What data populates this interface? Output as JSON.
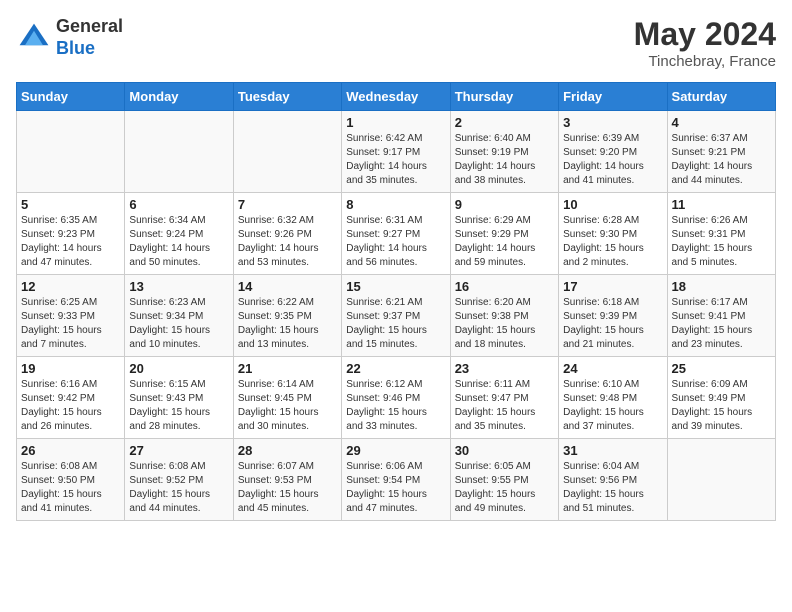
{
  "header": {
    "logo_general": "General",
    "logo_blue": "Blue",
    "month": "May 2024",
    "location": "Tinchebray, France"
  },
  "weekdays": [
    "Sunday",
    "Monday",
    "Tuesday",
    "Wednesday",
    "Thursday",
    "Friday",
    "Saturday"
  ],
  "weeks": [
    [
      {
        "day": "",
        "info": ""
      },
      {
        "day": "",
        "info": ""
      },
      {
        "day": "",
        "info": ""
      },
      {
        "day": "1",
        "info": "Sunrise: 6:42 AM\nSunset: 9:17 PM\nDaylight: 14 hours and 35 minutes."
      },
      {
        "day": "2",
        "info": "Sunrise: 6:40 AM\nSunset: 9:19 PM\nDaylight: 14 hours and 38 minutes."
      },
      {
        "day": "3",
        "info": "Sunrise: 6:39 AM\nSunset: 9:20 PM\nDaylight: 14 hours and 41 minutes."
      },
      {
        "day": "4",
        "info": "Sunrise: 6:37 AM\nSunset: 9:21 PM\nDaylight: 14 hours and 44 minutes."
      }
    ],
    [
      {
        "day": "5",
        "info": "Sunrise: 6:35 AM\nSunset: 9:23 PM\nDaylight: 14 hours and 47 minutes."
      },
      {
        "day": "6",
        "info": "Sunrise: 6:34 AM\nSunset: 9:24 PM\nDaylight: 14 hours and 50 minutes."
      },
      {
        "day": "7",
        "info": "Sunrise: 6:32 AM\nSunset: 9:26 PM\nDaylight: 14 hours and 53 minutes."
      },
      {
        "day": "8",
        "info": "Sunrise: 6:31 AM\nSunset: 9:27 PM\nDaylight: 14 hours and 56 minutes."
      },
      {
        "day": "9",
        "info": "Sunrise: 6:29 AM\nSunset: 9:29 PM\nDaylight: 14 hours and 59 minutes."
      },
      {
        "day": "10",
        "info": "Sunrise: 6:28 AM\nSunset: 9:30 PM\nDaylight: 15 hours and 2 minutes."
      },
      {
        "day": "11",
        "info": "Sunrise: 6:26 AM\nSunset: 9:31 PM\nDaylight: 15 hours and 5 minutes."
      }
    ],
    [
      {
        "day": "12",
        "info": "Sunrise: 6:25 AM\nSunset: 9:33 PM\nDaylight: 15 hours and 7 minutes."
      },
      {
        "day": "13",
        "info": "Sunrise: 6:23 AM\nSunset: 9:34 PM\nDaylight: 15 hours and 10 minutes."
      },
      {
        "day": "14",
        "info": "Sunrise: 6:22 AM\nSunset: 9:35 PM\nDaylight: 15 hours and 13 minutes."
      },
      {
        "day": "15",
        "info": "Sunrise: 6:21 AM\nSunset: 9:37 PM\nDaylight: 15 hours and 15 minutes."
      },
      {
        "day": "16",
        "info": "Sunrise: 6:20 AM\nSunset: 9:38 PM\nDaylight: 15 hours and 18 minutes."
      },
      {
        "day": "17",
        "info": "Sunrise: 6:18 AM\nSunset: 9:39 PM\nDaylight: 15 hours and 21 minutes."
      },
      {
        "day": "18",
        "info": "Sunrise: 6:17 AM\nSunset: 9:41 PM\nDaylight: 15 hours and 23 minutes."
      }
    ],
    [
      {
        "day": "19",
        "info": "Sunrise: 6:16 AM\nSunset: 9:42 PM\nDaylight: 15 hours and 26 minutes."
      },
      {
        "day": "20",
        "info": "Sunrise: 6:15 AM\nSunset: 9:43 PM\nDaylight: 15 hours and 28 minutes."
      },
      {
        "day": "21",
        "info": "Sunrise: 6:14 AM\nSunset: 9:45 PM\nDaylight: 15 hours and 30 minutes."
      },
      {
        "day": "22",
        "info": "Sunrise: 6:12 AM\nSunset: 9:46 PM\nDaylight: 15 hours and 33 minutes."
      },
      {
        "day": "23",
        "info": "Sunrise: 6:11 AM\nSunset: 9:47 PM\nDaylight: 15 hours and 35 minutes."
      },
      {
        "day": "24",
        "info": "Sunrise: 6:10 AM\nSunset: 9:48 PM\nDaylight: 15 hours and 37 minutes."
      },
      {
        "day": "25",
        "info": "Sunrise: 6:09 AM\nSunset: 9:49 PM\nDaylight: 15 hours and 39 minutes."
      }
    ],
    [
      {
        "day": "26",
        "info": "Sunrise: 6:08 AM\nSunset: 9:50 PM\nDaylight: 15 hours and 41 minutes."
      },
      {
        "day": "27",
        "info": "Sunrise: 6:08 AM\nSunset: 9:52 PM\nDaylight: 15 hours and 44 minutes."
      },
      {
        "day": "28",
        "info": "Sunrise: 6:07 AM\nSunset: 9:53 PM\nDaylight: 15 hours and 45 minutes."
      },
      {
        "day": "29",
        "info": "Sunrise: 6:06 AM\nSunset: 9:54 PM\nDaylight: 15 hours and 47 minutes."
      },
      {
        "day": "30",
        "info": "Sunrise: 6:05 AM\nSunset: 9:55 PM\nDaylight: 15 hours and 49 minutes."
      },
      {
        "day": "31",
        "info": "Sunrise: 6:04 AM\nSunset: 9:56 PM\nDaylight: 15 hours and 51 minutes."
      },
      {
        "day": "",
        "info": ""
      }
    ]
  ]
}
